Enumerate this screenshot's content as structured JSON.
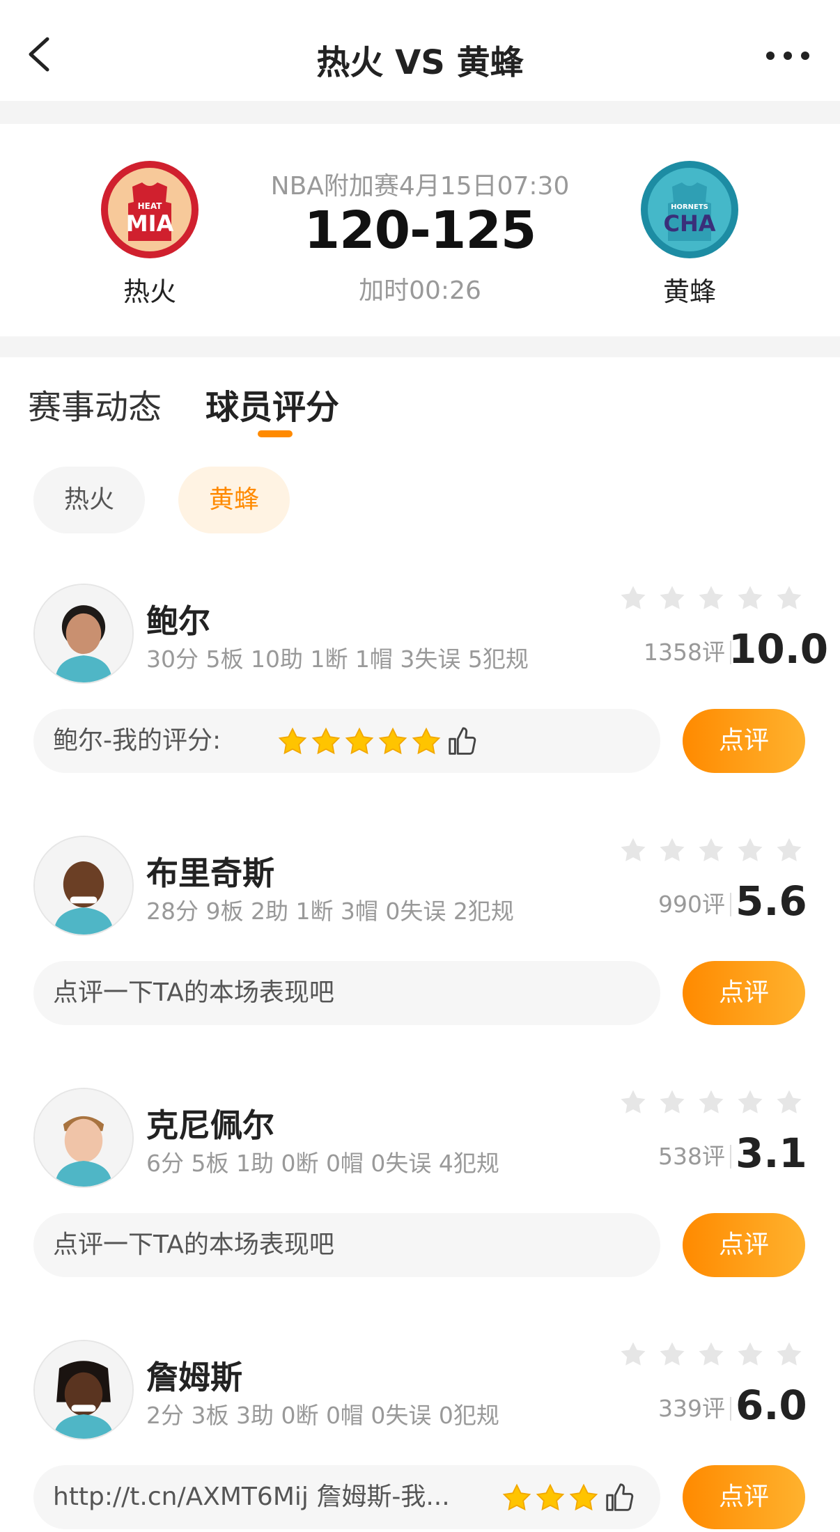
{
  "header": {
    "title": "热火 VS 黄蜂"
  },
  "match": {
    "info": "NBA附加赛4月15日07:30",
    "score": "120-125",
    "time": "加时00:26",
    "home": {
      "name": "热火",
      "logo_text_top": "HEAT",
      "logo_text_main": "MIA",
      "color": "#d0202e"
    },
    "away": {
      "name": "黄蜂",
      "logo_text_top": "HORNETS",
      "logo_text_main": "CHA",
      "color": "#1d8ca3"
    }
  },
  "tabs": [
    {
      "label": "赛事动态",
      "active": false
    },
    {
      "label": "球员评分",
      "active": true
    }
  ],
  "team_filter": [
    {
      "label": "热火",
      "active": false
    },
    {
      "label": "黄蜂",
      "active": true
    }
  ],
  "players": [
    {
      "name": "鲍尔",
      "stats": "30分 5板 10助 1断 1帽 3失误 5犯规",
      "reviews": "1358评",
      "score": "10.0",
      "comment": "鲍尔-我的评分:",
      "my_stars": 5,
      "button": "点评"
    },
    {
      "name": "布里奇斯",
      "stats": "28分 9板 2助 1断 3帽 0失误 2犯规",
      "reviews": "990评",
      "score": "5.6",
      "comment": "点评一下TA的本场表现吧",
      "my_stars": 0,
      "button": "点评"
    },
    {
      "name": "克尼佩尔",
      "stats": "6分 5板 1助 0断 0帽 0失误 4犯规",
      "reviews": "538评",
      "score": "3.1",
      "comment": "点评一下TA的本场表现吧",
      "my_stars": 0,
      "button": "点评"
    },
    {
      "name": "詹姆斯",
      "stats": "2分 3板 3助 0断 0帽 0失误 0犯规",
      "reviews": "339评",
      "score": "6.0",
      "comment": "http://t.cn/AXMT6Mij 詹姆斯-我...",
      "my_stars": 3,
      "button": "点评"
    }
  ],
  "colors": {
    "accent": "#ff8a00",
    "star_gold": "#ffc400",
    "star_empty": "#e6e6e6"
  }
}
